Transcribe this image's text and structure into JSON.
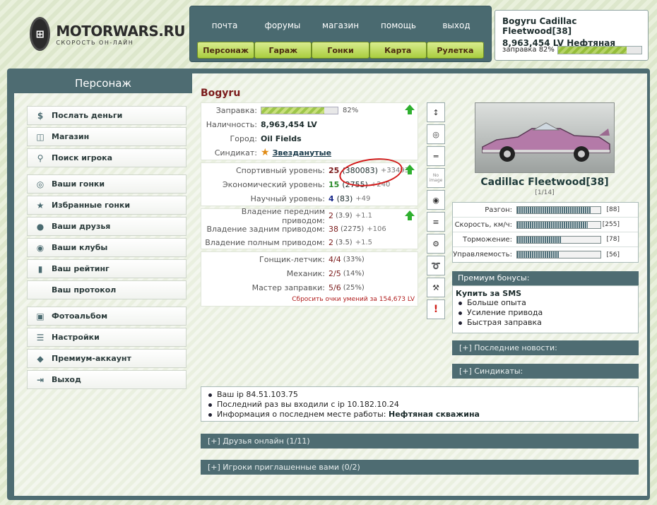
{
  "logo": {
    "mark": "⊞",
    "title": "MOTORWARS.RU",
    "subtitle": "СКОРОСТЬ ОН-ЛАЙН"
  },
  "topnav": {
    "links": [
      "почта",
      "форумы",
      "магазин",
      "помощь",
      "выход"
    ],
    "buttons": [
      "Персонаж",
      "Гараж",
      "Гонки",
      "Карта",
      "Рулетка"
    ]
  },
  "userbox": {
    "name": "Bogyru Cadillac Fleetwood[38]",
    "money": "8,963,454 LV Нефтяная",
    "fuel_label": "заправка 82%",
    "fuel_level": 0.82
  },
  "left": {
    "title": "Персонаж",
    "menu": [
      {
        "label": "Послать деньги",
        "icon": "money-icon"
      },
      {
        "label": "Магазин",
        "icon": "shop-icon"
      },
      {
        "label": "Поиск игрока",
        "icon": "search-icon"
      },
      {
        "label": "Ваши гонки",
        "icon": "steering-wheel-icon"
      },
      {
        "label": "Избранные гонки",
        "icon": "favorite-races-icon"
      },
      {
        "label": "Ваши друзья",
        "icon": "friends-icon"
      },
      {
        "label": "Ваши клубы",
        "icon": "clubs-icon"
      },
      {
        "label": "Ваш рейтинг",
        "icon": "rating-icon"
      },
      {
        "label": "Ваш протокол",
        "icon": ""
      },
      {
        "label": "Фотоальбом",
        "icon": "photo-album-icon"
      },
      {
        "label": "Настройки",
        "icon": "settings-icon"
      },
      {
        "label": "Премиум-аккаунт",
        "icon": "premium-icon"
      },
      {
        "label": "Выход",
        "icon": "exit-icon"
      }
    ]
  },
  "character": {
    "name": "Bogyru",
    "fuel": {
      "label": "Заправка:",
      "pct": "82%",
      "level": 0.82
    },
    "cash": {
      "label": "Наличность:",
      "value": "8,963,454 LV"
    },
    "city": {
      "label": "Город:",
      "value": "Oil Fields"
    },
    "syndicate": {
      "label": "Синдикат:",
      "value": "Звезданутые"
    },
    "levels": [
      {
        "label": "Спортивный уровень:",
        "value": "25",
        "sub": "(380083)",
        "delta": "+33493",
        "color": "#7a1a1a"
      },
      {
        "label": "Экономический уровень:",
        "value": "15",
        "sub": "(2755)",
        "delta": "+240",
        "color": "#2a8a2a"
      },
      {
        "label": "Научный уровень:",
        "value": "4",
        "sub": "(83)",
        "delta": "+49",
        "color": "#1a2a8a"
      }
    ],
    "drives": [
      {
        "label": "Владение передним приводом:",
        "value": "2",
        "sub": "(3.9)",
        "delta": "+1.1"
      },
      {
        "label": "Владение задним приводом:",
        "value": "38",
        "sub": "(2275)",
        "delta": "+106"
      },
      {
        "label": "Владение полным приводом:",
        "value": "2",
        "sub": "(3.5)",
        "delta": "+1.5"
      }
    ],
    "skills": [
      {
        "label": "Гонщик-летчик:",
        "value": "4/4",
        "sub": "(33%)"
      },
      {
        "label": "Механик:",
        "value": "2/5",
        "sub": "(14%)"
      },
      {
        "label": "Мастер заправки:",
        "value": "5/6",
        "sub": "(25%)"
      }
    ],
    "reset": "Сбросить очки умений за 154,673 LV"
  },
  "parts": [
    {
      "icon": "suspension-icon",
      "glyph": "↕"
    },
    {
      "icon": "tire-icon",
      "glyph": "◎"
    },
    {
      "icon": "exhaust-icon",
      "glyph": "═"
    },
    {
      "icon": "no-image-icon",
      "glyph": "No image"
    },
    {
      "icon": "brake-disc-icon",
      "glyph": "◉"
    },
    {
      "icon": "shock-absorber-icon",
      "glyph": "≡"
    },
    {
      "icon": "turbo-icon",
      "glyph": "⚙"
    },
    {
      "icon": "cable-icon",
      "glyph": "➰"
    },
    {
      "icon": "tools-icon",
      "glyph": "⚒"
    },
    {
      "icon": "warning-icon",
      "glyph": "!"
    }
  ],
  "car": {
    "name": "Cadillac Fleetwood[38]",
    "count": "[1/14]",
    "stats": [
      {
        "label": "Разгон:",
        "value": "[88]",
        "level": 0.88
      },
      {
        "label": "Скорость, км/ч:",
        "value": "[255]",
        "level": 0.85
      },
      {
        "label": "Торможение:",
        "value": "[78]",
        "level": 0.53
      },
      {
        "label": "Управляемость:",
        "value": "[56]",
        "level": 0.5
      }
    ]
  },
  "premium": {
    "header": "Премиум бонусы:",
    "title": "Купить за SMS",
    "items": [
      "Больше опыта",
      "Усиление привода",
      "Быстрая заправка"
    ]
  },
  "sections": {
    "news": "[+]  Последние новости:",
    "syndicates": "[+]  Синдикаты:",
    "friends_online": "[+]  Друзья онлайн (1/11)",
    "invited": "[+]  Игроки приглашенные вами (0/2)"
  },
  "info": {
    "ip": "Ваш ip 84.51.103.75",
    "last_login": "Последний раз вы входили с ip 10.182.10.24",
    "work_label": "Информация о последнем месте работы: ",
    "work_value": "Нефтяная скважина"
  }
}
